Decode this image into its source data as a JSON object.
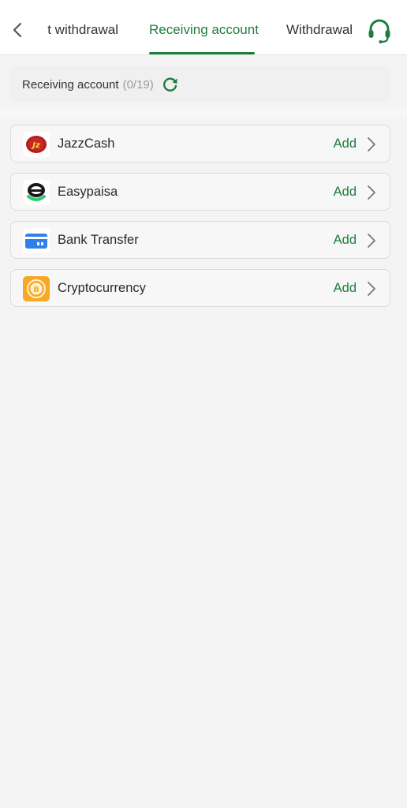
{
  "header": {
    "tabs": [
      {
        "label": "t withdrawal"
      },
      {
        "label": "Receiving account"
      },
      {
        "label": "Withdrawal"
      }
    ],
    "active_tab_index": 1,
    "accent_color": "#1e7d3d"
  },
  "summary": {
    "label": "Receiving account",
    "count": "(0/19)"
  },
  "accounts": [
    {
      "name": "JazzCash",
      "action": "Add",
      "icon": "jazzcash-logo"
    },
    {
      "name": "Easypaisa",
      "action": "Add",
      "icon": "easypaisa-logo"
    },
    {
      "name": "Bank Transfer",
      "action": "Add",
      "icon": "bank-card-icon"
    },
    {
      "name": "Cryptocurrency",
      "action": "Add",
      "icon": "crypto-coin-icon"
    }
  ]
}
